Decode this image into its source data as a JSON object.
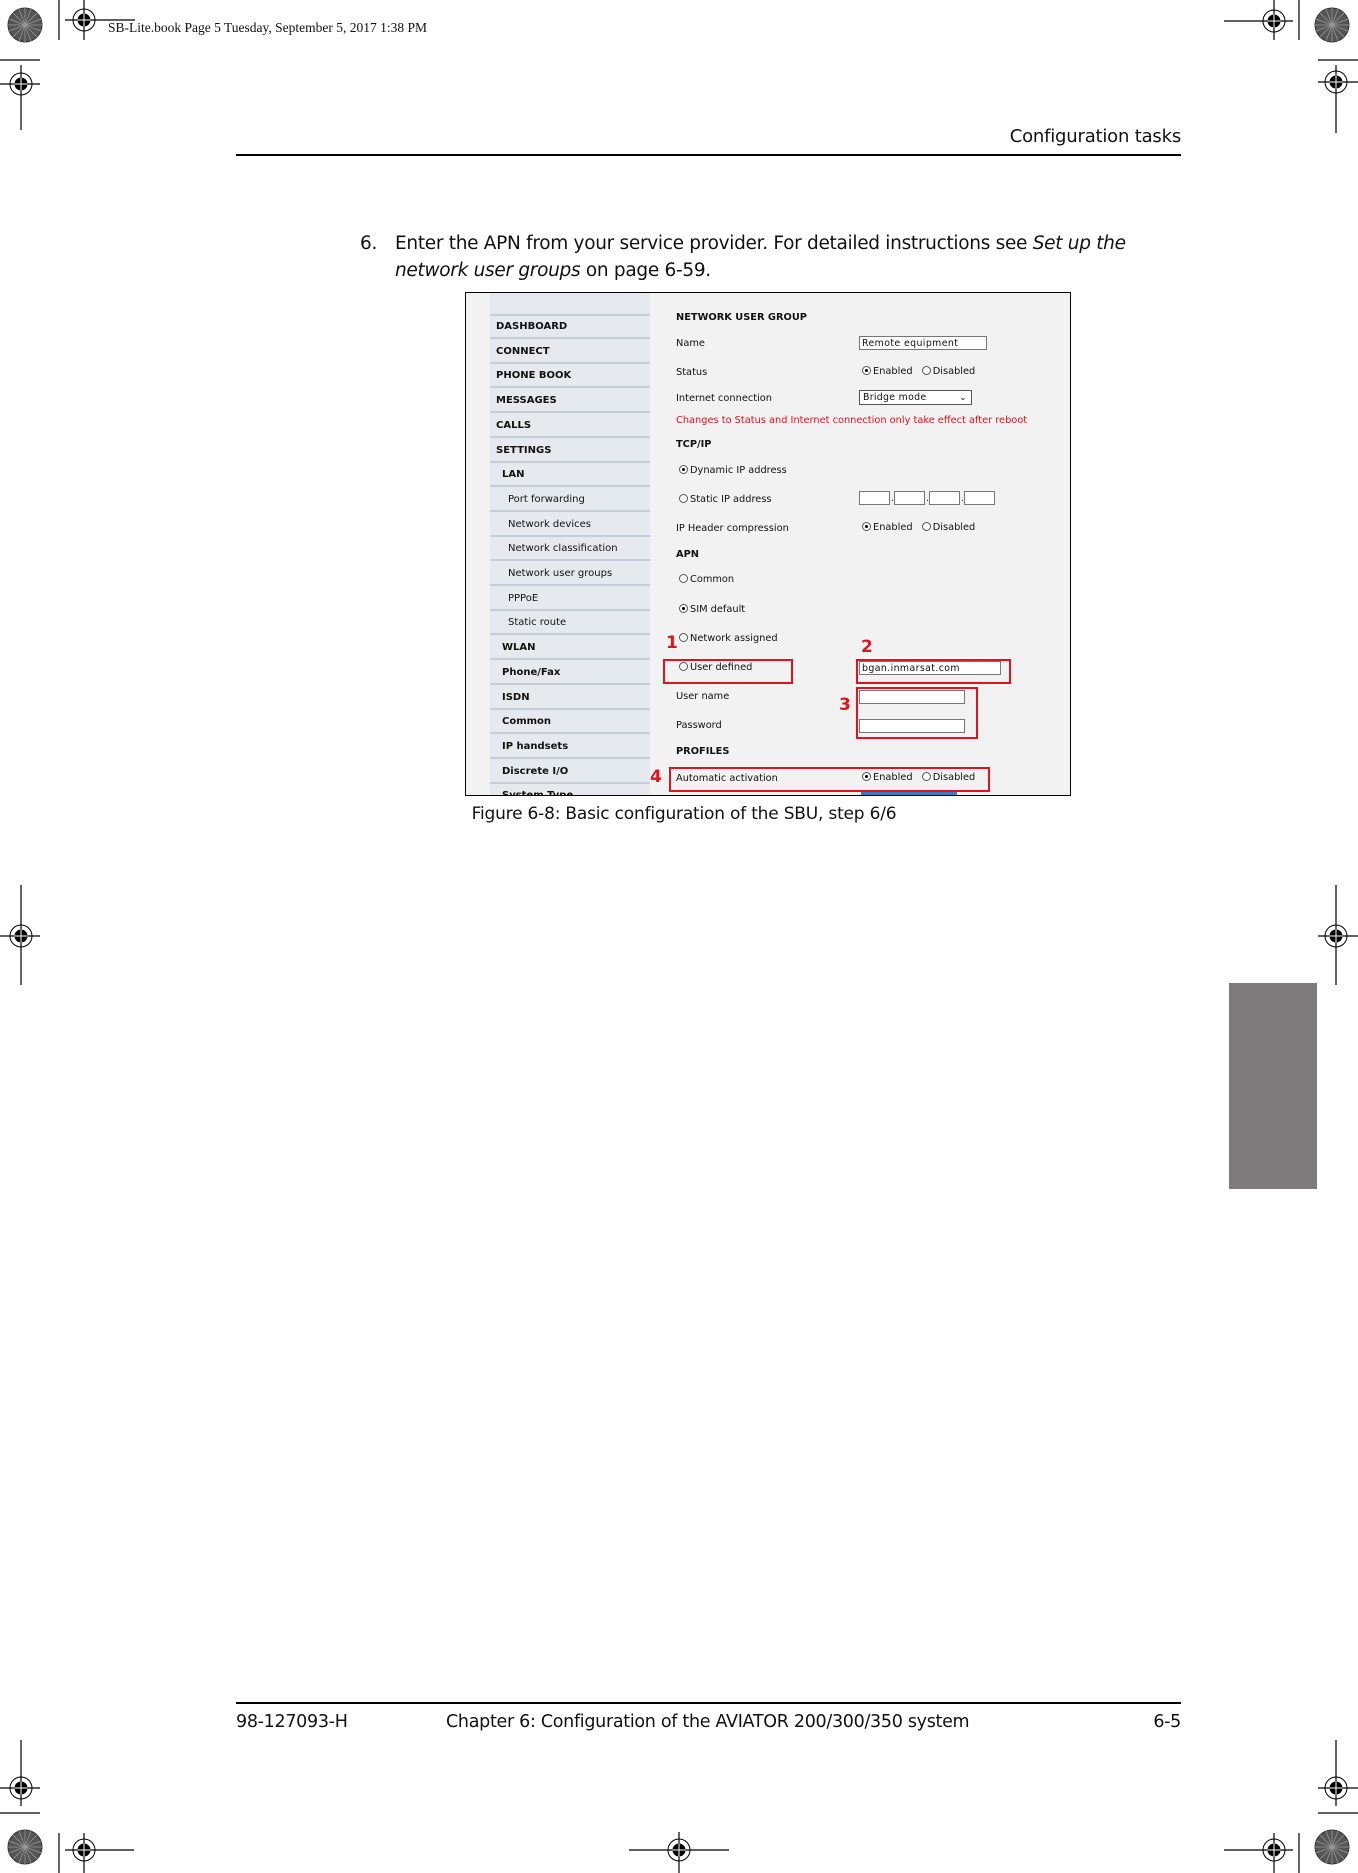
{
  "print_slug": "SB-Lite.book  Page 5  Tuesday, September 5, 2017  1:38 PM",
  "header": {
    "section_title": "Configuration tasks"
  },
  "step": {
    "number": "6.",
    "text_before": "Enter the APN from your service provider. For detailed instructions see ",
    "link_italic_1": "Set up the",
    "link_italic_2": "network user groups",
    "text_after": " on page 6-59."
  },
  "figure": {
    "caption": "Figure 6-8: Basic configuration of the SBU, step 6/6",
    "sidebar": {
      "items": [
        {
          "label": "DASHBOARD",
          "level": "top"
        },
        {
          "label": "CONNECT",
          "level": "top"
        },
        {
          "label": "PHONE BOOK",
          "level": "top"
        },
        {
          "label": "MESSAGES",
          "level": "top"
        },
        {
          "label": "CALLS",
          "level": "top"
        },
        {
          "label": "SETTINGS",
          "level": "top"
        },
        {
          "label": "LAN",
          "level": "sub"
        },
        {
          "label": "Port forwarding",
          "level": "sub2"
        },
        {
          "label": "Network devices",
          "level": "sub2"
        },
        {
          "label": "Network classification",
          "level": "sub2"
        },
        {
          "label": "Network user groups",
          "level": "sub2"
        },
        {
          "label": "PPPoE",
          "level": "sub2"
        },
        {
          "label": "Static route",
          "level": "sub2"
        },
        {
          "label": "WLAN",
          "level": "sub"
        },
        {
          "label": "Phone/Fax",
          "level": "sub"
        },
        {
          "label": "ISDN",
          "level": "sub"
        },
        {
          "label": "Common",
          "level": "sub"
        },
        {
          "label": "IP handsets",
          "level": "sub"
        },
        {
          "label": "Discrete I/O",
          "level": "sub"
        },
        {
          "label": "System Type",
          "level": "sub"
        }
      ]
    },
    "form": {
      "title": "NETWORK USER GROUP",
      "name_label": "Name",
      "name_value": "Remote equipment",
      "status_label": "Status",
      "status_enabled": "Enabled",
      "status_disabled": "Disabled",
      "status_selected": "Enabled",
      "internet_label": "Internet connection",
      "internet_value": "Bridge mode",
      "reboot_warning": "Changes to Status and Internet connection only take effect after reboot",
      "tcpip_heading": "TCP/IP",
      "dynamic_ip_label": "Dynamic IP address",
      "static_ip_label": "Static IP address",
      "ip_selected": "Dynamic IP address",
      "static_ip_octets": [
        "",
        "",
        "",
        ""
      ],
      "ip_header_label": "IP Header compression",
      "ip_header_enabled": "Enabled",
      "ip_header_disabled": "Disabled",
      "ip_header_selected": "Enabled",
      "apn_heading": "APN",
      "apn_common": "Common",
      "apn_sim_default": "SIM default",
      "apn_network_assigned": "Network assigned",
      "apn_user_defined": "User defined",
      "apn_selected": "SIM default",
      "apn_user_defined_value": "bgan.inmarsat.com",
      "username_label": "User name",
      "username_value": "",
      "password_label": "Password",
      "password_value": "",
      "profiles_heading": "PROFILES",
      "auto_activation_label": "Automatic activation",
      "auto_enabled": "Enabled",
      "auto_disabled": "Disabled",
      "auto_selected": "Enabled"
    },
    "callouts": [
      "1",
      "2",
      "3",
      "4"
    ],
    "callout_color": "#e0141e"
  },
  "footer": {
    "doc_number": "98-127093-H",
    "chapter": "Chapter 6:  Configuration of the AVIATOR 200/300/350 system",
    "page": "6-5"
  },
  "colors": {
    "thumb_tab": "#7d7b7c",
    "sidebar_bg": "#e6e9ee",
    "warning_red": "#e0141e"
  }
}
